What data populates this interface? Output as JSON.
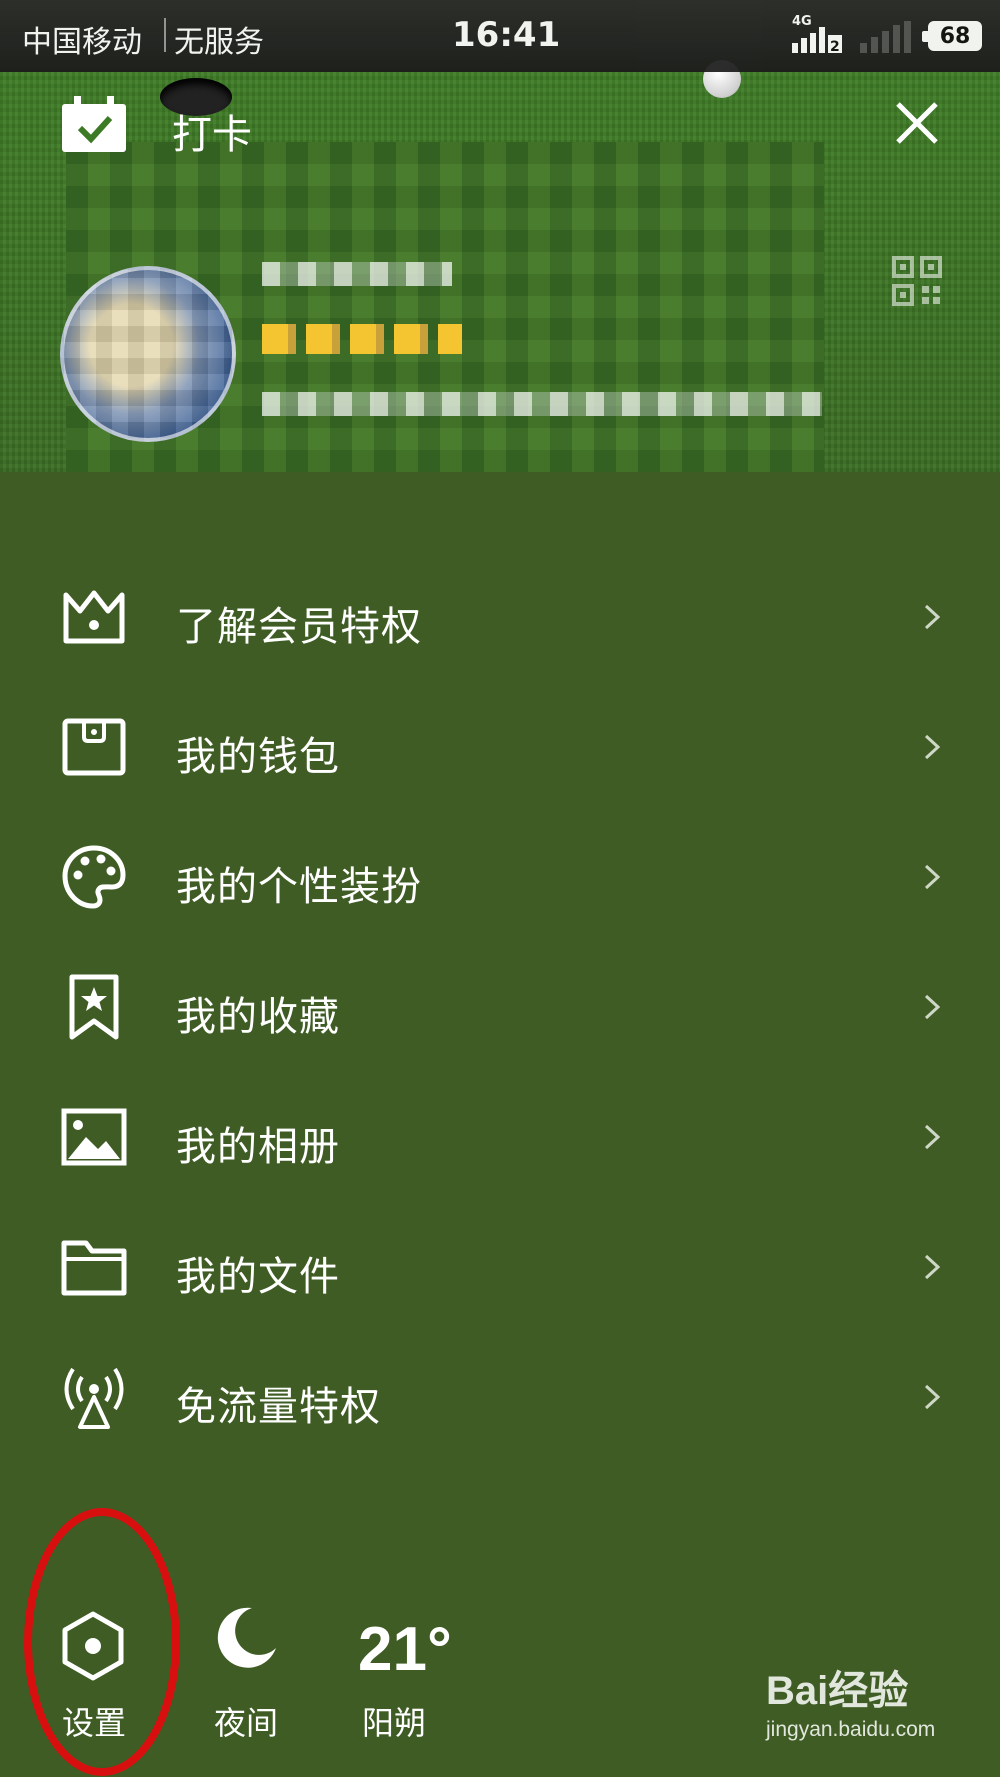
{
  "status_bar": {
    "carrier": "中国移动",
    "service": "无服务",
    "time": "16:41",
    "network": "4G",
    "sim_slot": "2",
    "battery": "68"
  },
  "header": {
    "checkin_label": "打卡",
    "close_icon": "close-icon",
    "qr_icon": "qr-code-icon"
  },
  "menu": {
    "items": [
      {
        "label": "了解会员特权",
        "icon": "crown-icon"
      },
      {
        "label": "我的钱包",
        "icon": "wallet-icon"
      },
      {
        "label": "我的个性装扮",
        "icon": "palette-icon"
      },
      {
        "label": "我的收藏",
        "icon": "bookmark-star-icon"
      },
      {
        "label": "我的相册",
        "icon": "image-icon"
      },
      {
        "label": "我的文件",
        "icon": "folder-icon"
      },
      {
        "label": "免流量特权",
        "icon": "broadcast-tower-icon"
      }
    ]
  },
  "bottom": {
    "settings_label": "设置",
    "night_label": "夜间",
    "temperature": "21°",
    "city": "阳朔"
  },
  "watermark": {
    "brand": "Bai经验",
    "url": "jingyan.baidu.com"
  },
  "colors": {
    "panel_bg": "#3e5c24",
    "highlight_ring": "#d80f0f"
  }
}
